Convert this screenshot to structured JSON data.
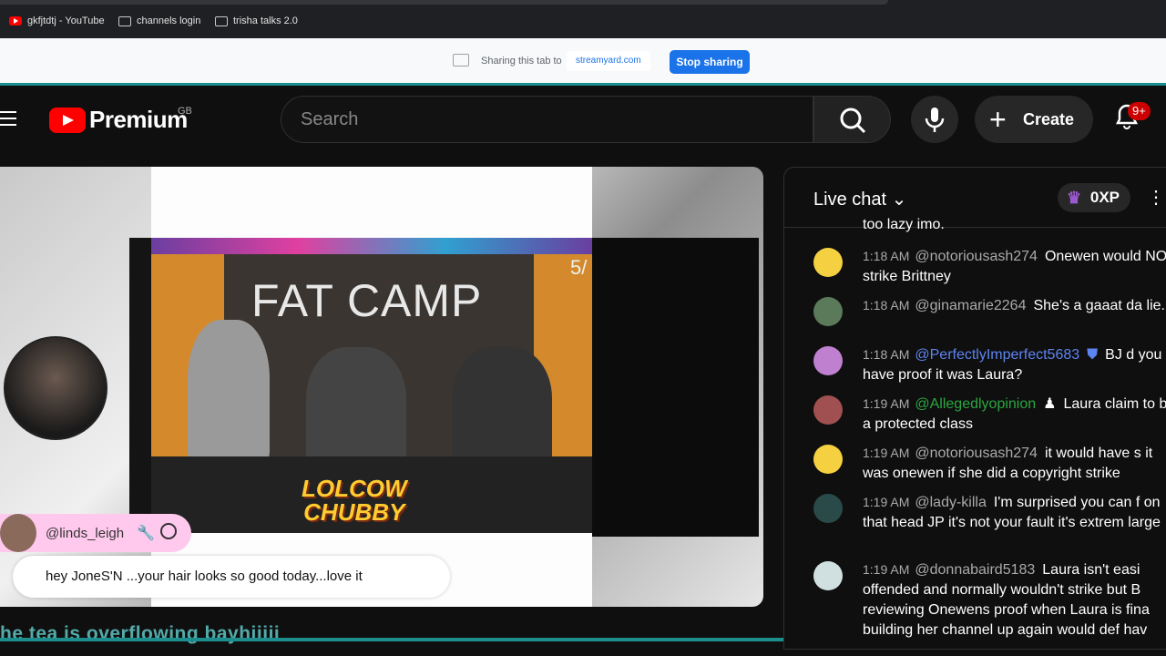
{
  "bookmarks": [
    {
      "label": "gkfjtdtj - YouTube",
      "icon": "youtube-icon"
    },
    {
      "label": "channels login",
      "icon": "folder-icon"
    },
    {
      "label": "trisha talks 2.0",
      "icon": "folder-icon"
    }
  ],
  "share": {
    "text": "Sharing this tab to",
    "host": "streamyard.com",
    "stop_label": "Stop sharing"
  },
  "header": {
    "logo_text": "Premium",
    "region": "GB",
    "search_placeholder": "Search",
    "create_label": "Create",
    "notifications_badge": "9+"
  },
  "stream": {
    "video_title": "FAT CAMP",
    "page_indicator": "5/",
    "overlay_logo_line1": "LOLCOW",
    "overlay_logo_line2": "CHUBBY",
    "commenter": "@linds_leigh",
    "comment_text": "hey JoneS'N ...your hair looks so good today...love it",
    "ticker_text": "he tea is overflowing bayhiiiii"
  },
  "chat": {
    "title": "Live chat",
    "xp": "0XP",
    "cut_text": "too lazy imo.",
    "messages": [
      {
        "time": "1:18 AM",
        "author": "@notoriousash274",
        "role": "",
        "text": "Onewen would NOT strike Brittney",
        "avatar_color": "#f5d040"
      },
      {
        "time": "1:18 AM",
        "author": "@ginamarie2264",
        "role": "",
        "text": "She's a gaaat da lie.",
        "avatar_color": "#5a7a5a"
      },
      {
        "time": "1:18 AM",
        "author": "@PerfectlyImperfect5683",
        "role": "mod",
        "text": "BJ d you have proof it was Laura?",
        "avatar_color": "#c080d0"
      },
      {
        "time": "1:19 AM",
        "author": "@Allegedlyopinion",
        "role": "mem",
        "text": "Laura claim to be a protected class",
        "avatar_color": "#a05050"
      },
      {
        "time": "1:19 AM",
        "author": "@notoriousash274",
        "role": "",
        "text": "it would have s it was onewen if she did a copyright strike",
        "avatar_color": "#f5d040"
      },
      {
        "time": "1:19 AM",
        "author": "@lady-killa",
        "role": "",
        "text": "I'm surprised you can f on that head JP it's not your fault it's extrem large",
        "avatar_color": "#2a4a4a"
      },
      {
        "time": "1:19 AM",
        "author": "@donnabaird5183",
        "role": "",
        "text": "Laura isn't easi offended and normally wouldn't strike but B reviewing Onewens proof when Laura is fina building her channel up again would def hav",
        "avatar_color": "#d0e0e0"
      }
    ]
  }
}
